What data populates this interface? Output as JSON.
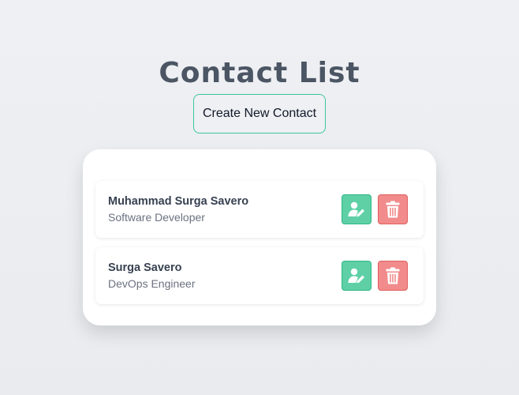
{
  "page": {
    "title": "Contact List"
  },
  "actions": {
    "create_label": "Create New Contact"
  },
  "contacts": [
    {
      "name": "Muhammad Surga Savero",
      "role": "Software Developer"
    },
    {
      "name": "Surga Savero",
      "role": "DevOps Engineer"
    }
  ],
  "icons": {
    "edit": "user-edit-icon",
    "delete": "trash-icon"
  },
  "colors": {
    "accent_green": "#3cc69c",
    "edit_button": "#5fd0a6",
    "delete_button": "#f28b8b",
    "title_text": "#4b5563"
  }
}
